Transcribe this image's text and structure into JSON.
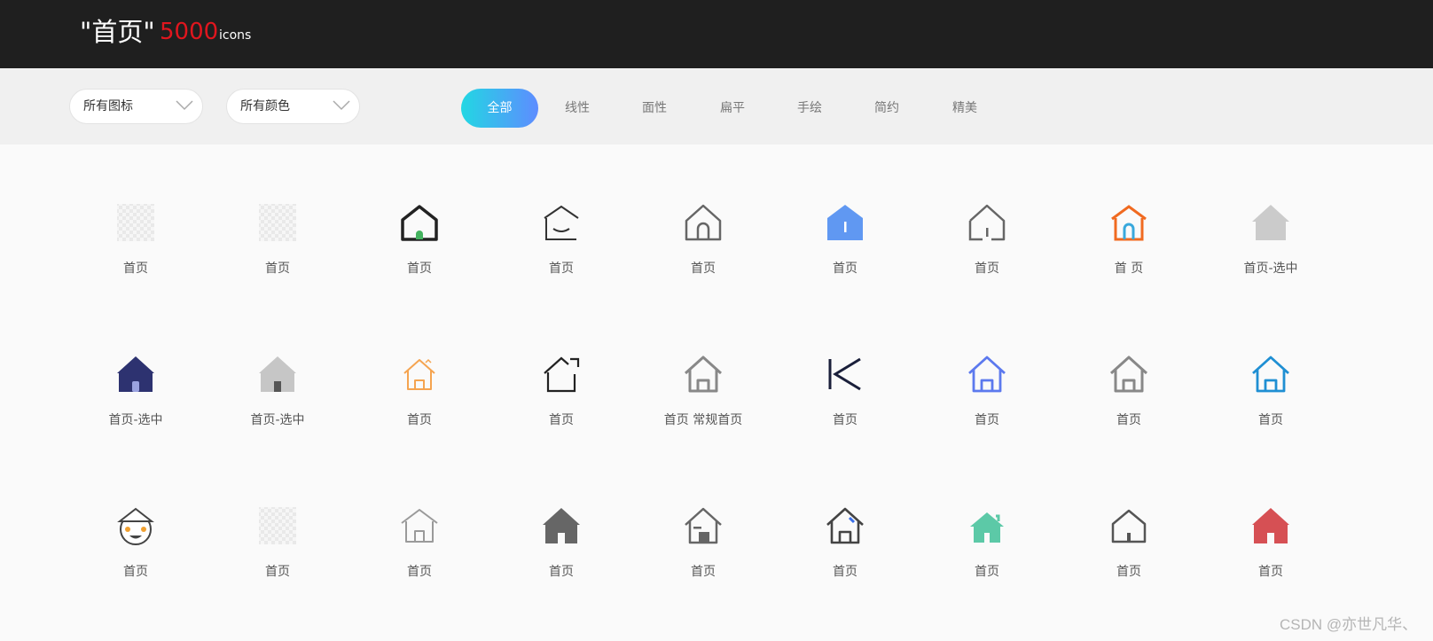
{
  "header": {
    "title_prefix": "\"首页\"",
    "count": "5000",
    "unit": "icons"
  },
  "filters": {
    "icon_type": "所有图标",
    "color": "所有颜色"
  },
  "tabs": [
    "全部",
    "线性",
    "面性",
    "扁平",
    "手绘",
    "简约",
    "精美"
  ],
  "active_tab": 0,
  "icons": [
    {
      "label": "首页",
      "icon": "checker-house-icon"
    },
    {
      "label": "首页",
      "icon": "checker-house-icon"
    },
    {
      "label": "首页",
      "icon": "house-outline-green-door-icon"
    },
    {
      "label": "首页",
      "icon": "house-smile-outline-icon"
    },
    {
      "label": "首页",
      "icon": "house-arch-door-icon"
    },
    {
      "label": "首页",
      "icon": "house-filled-blue-icon"
    },
    {
      "label": "首页",
      "icon": "house-outline-gap-icon"
    },
    {
      "label": "首 页",
      "icon": "house-orange-blue-door-icon"
    },
    {
      "label": "首页-选中",
      "icon": "house-filled-gray-icon"
    },
    {
      "label": "首页-选中",
      "icon": "house-filled-navy-icon"
    },
    {
      "label": "首页-选中",
      "icon": "house-filled-gray-dark-door-icon"
    },
    {
      "label": "首页",
      "icon": "house-outline-orange-icon"
    },
    {
      "label": "首页",
      "icon": "house-open-corner-icon"
    },
    {
      "label": "首页 常规首页",
      "icon": "house-outline-gray-icon"
    },
    {
      "label": "首页",
      "icon": "k-shape-icon"
    },
    {
      "label": "首页",
      "icon": "house-outline-blue-icon"
    },
    {
      "label": "首页",
      "icon": "house-outline-gray-icon"
    },
    {
      "label": "首页",
      "icon": "house-outline-cyan-icon"
    },
    {
      "label": "首页",
      "icon": "smiling-face-hat-icon"
    },
    {
      "label": "首页",
      "icon": "checker-house-icon"
    },
    {
      "label": "首页",
      "icon": "house-outline-light-gray-icon"
    },
    {
      "label": "首页",
      "icon": "house-filled-dark-gray-icon"
    },
    {
      "label": "首页",
      "icon": "house-window-door-icon"
    },
    {
      "label": "首页",
      "icon": "house-blue-accent-icon"
    },
    {
      "label": "首页",
      "icon": "house-filled-teal-icon"
    },
    {
      "label": "首页",
      "icon": "house-outline-small-icon"
    },
    {
      "label": "首页",
      "icon": "house-filled-red-icon"
    }
  ],
  "watermark": "CSDN @亦世凡华、",
  "colors": {
    "header_bg": "#1f1f1f",
    "count": "#e0161e",
    "tab_gradient_start": "#22d7e3",
    "tab_gradient_end": "#5e8cff"
  }
}
